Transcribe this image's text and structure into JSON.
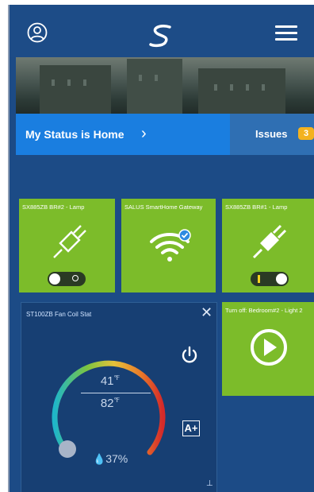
{
  "header": {
    "profile_icon": "user-circle-icon",
    "logo": "salus-logo-icon",
    "menu_icon": "hamburger-menu-icon"
  },
  "status": {
    "label": "My Status is Home",
    "chevron": "›",
    "issues_label": "Issues",
    "issues_count": "3"
  },
  "tiles": [
    {
      "title": "SX885ZB BR#2 - Lamp",
      "icon": "plug-unplugged-icon",
      "toggle_state": "off"
    },
    {
      "title": "SALUS SmartHome Gateway",
      "icon": "wifi-check-icon"
    },
    {
      "title": "SX885ZB BR#1 - Lamp",
      "icon": "plug-plugged-icon",
      "toggle_state": "on"
    }
  ],
  "thermostat": {
    "title": "ST100ZB Fan Coil Stat",
    "close": "✕",
    "current_temp": "41",
    "set_temp": "82",
    "unit": "℉",
    "humidity": "37%",
    "aplus": "A+",
    "pin": "⊥"
  },
  "scene": {
    "title": "Turn off: Bedroom#2 - Light 2",
    "icon": "play-circle-icon"
  },
  "colors": {
    "background": "#1c4b86",
    "tile_green": "#7cbc2a",
    "status_blue": "#1a7ee0",
    "badge": "#f3b21f"
  }
}
